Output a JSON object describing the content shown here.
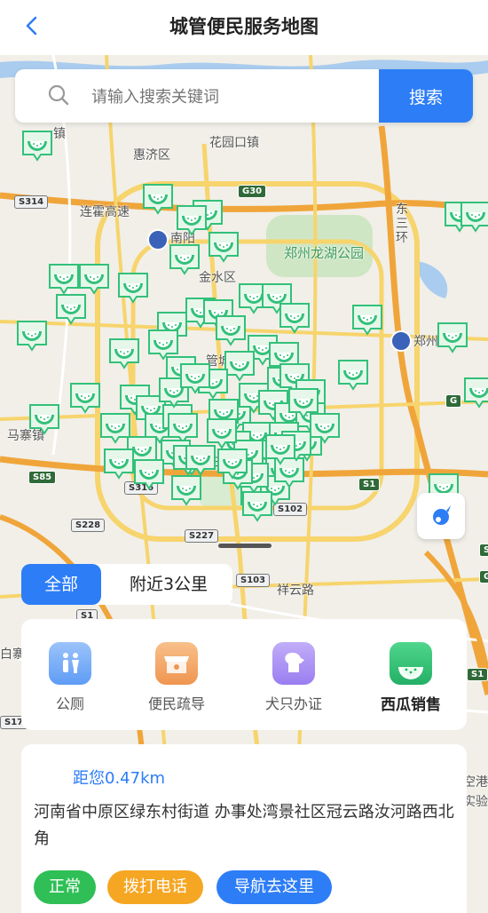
{
  "header": {
    "title": "城管便民服务地图"
  },
  "search": {
    "placeholder": "请输入搜索关键词",
    "button": "搜索"
  },
  "map_labels": {
    "places": [
      "镇",
      "惠济区",
      "花园口镇",
      "连霍高速",
      "南阳",
      "郑州龙湖公园",
      "金水区",
      "东三环",
      "郑州",
      "管城",
      "马寨镇",
      "三",
      "祥云路",
      "白寨",
      "空港",
      "实验"
    ],
    "roads": [
      "S314",
      "G30",
      "S85",
      "S316",
      "S228",
      "S227",
      "S103",
      "S102",
      "S1",
      "S1",
      "G",
      "S17",
      "S1",
      "S",
      "G"
    ]
  },
  "tabs": {
    "all": "全部",
    "nearby": "附近3公里"
  },
  "categories": [
    {
      "label": "公厕",
      "icon": "toilet-icon",
      "color": "#6aa6f7"
    },
    {
      "label": "便民疏导",
      "icon": "vendor-stall-icon",
      "color": "#f3a35c"
    },
    {
      "label": "犬只办证",
      "icon": "dog-icon",
      "color": "#a88af0"
    },
    {
      "label": "西瓜销售",
      "icon": "watermelon-icon",
      "color": "#33c07a"
    }
  ],
  "card": {
    "distance": "距您0.47km",
    "address": "河南省中原区绿东村街道 办事处湾景社区冠云路汝河路西北角",
    "status": "正常",
    "call": "拨打电话",
    "navigate": "导航去这里"
  },
  "colors": {
    "accent": "#2d7df6",
    "pin": "#33c07a"
  }
}
